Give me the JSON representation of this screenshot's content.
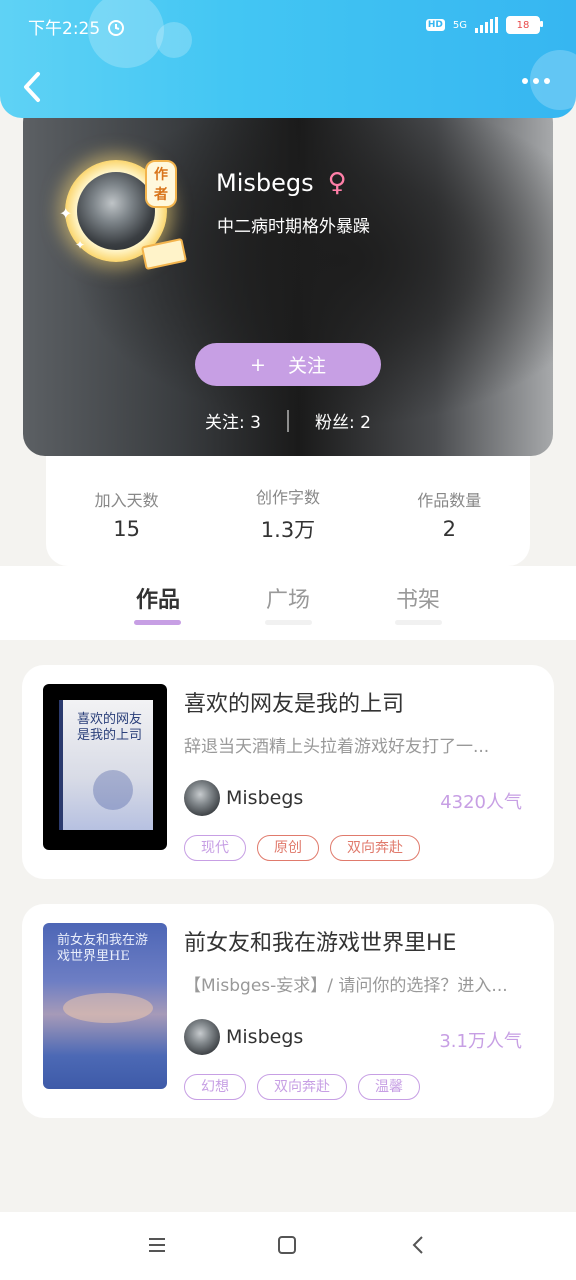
{
  "status_bar": {
    "time": "下午2:25",
    "hd": "HD",
    "network": "5G",
    "battery": "18"
  },
  "profile": {
    "name": "Misbegs",
    "gender_symbol": "♀",
    "bio": "中二病时期格外暴躁",
    "author_badge": "作者",
    "follow_plus": "+",
    "follow_label": "关注",
    "following": "关注: 3",
    "followers": "粉丝: 2"
  },
  "stats": [
    {
      "label": "加入天数",
      "value": "15"
    },
    {
      "label": "创作字数",
      "value": "1.3万"
    },
    {
      "label": "作品数量",
      "value": "2"
    }
  ],
  "tabs": [
    {
      "label": "作品",
      "active": true
    },
    {
      "label": "广场",
      "active": false
    },
    {
      "label": "书架",
      "active": false
    }
  ],
  "works": [
    {
      "title": "喜欢的网友是我的上司",
      "description": "辞退当天酒精上头拉着游戏好友打了一...",
      "author": "Misbegs",
      "popularity": "4320人气",
      "cover_text": "喜欢的网友是我的上司",
      "tags": [
        {
          "label": "现代",
          "color": "purple"
        },
        {
          "label": "原创",
          "color": "red"
        },
        {
          "label": "双向奔赴",
          "color": "red"
        }
      ]
    },
    {
      "title": "前女友和我在游戏世界里HE",
      "description": "【Misbges-妄求】/ 请问你的选择？进入...",
      "author": "Misbegs",
      "popularity": "3.1万人气",
      "cover_text": "前女友和我在游戏世界里HE",
      "tags": [
        {
          "label": "幻想",
          "color": "purple"
        },
        {
          "label": "双向奔赴",
          "color": "purple"
        },
        {
          "label": "温馨",
          "color": "purple"
        }
      ]
    }
  ],
  "colors": {
    "accent": "#c79fe4",
    "header": "#43c6f3",
    "tag_red": "#e07a6c"
  }
}
